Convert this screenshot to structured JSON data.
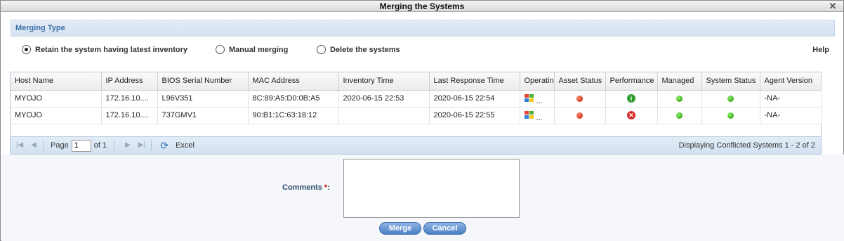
{
  "window": {
    "title": "Merging the Systems",
    "close_label": "✕"
  },
  "section": {
    "title": "Merging Type"
  },
  "merge_options": [
    {
      "label": "Retain the system having latest inventory",
      "checked": true
    },
    {
      "label": "Manual merging",
      "checked": false
    },
    {
      "label": "Delete the systems",
      "checked": false
    }
  ],
  "help_label": "Help",
  "grid": {
    "columns": [
      "Host Name",
      "IP Address",
      "BIOS Serial Number",
      "MAC Address",
      "Inventory Time",
      "Last Response Time",
      "Operating",
      "Asset Status",
      "Performance",
      "Managed",
      "System Status",
      "Agent Version"
    ],
    "rows": [
      {
        "host": "MYOJO",
        "ip": "172.16.10....",
        "bios": "L96V351",
        "mac": "8C:89:A5:D0:0B:A5",
        "inventory": "2020-06-15 22:53",
        "last_response": "2020-06-15 22:54",
        "os_icon": "windows-logo-icon",
        "os_more": "...",
        "asset_status": "red",
        "performance": "info",
        "managed": "green",
        "system_status": "green",
        "agent_version": "-NA-"
      },
      {
        "host": "MYOJO",
        "ip": "172.16.10....",
        "bios": "737GMV1",
        "mac": "90:B1:1C:63:18:12",
        "inventory": "",
        "last_response": "2020-06-15 22:55",
        "os_icon": "windows-logo-icon",
        "os_more": "...",
        "asset_status": "red",
        "performance": "error",
        "managed": "green",
        "system_status": "green",
        "agent_version": "-NA-"
      }
    ]
  },
  "pager": {
    "page_label": "Page",
    "page_value": "1",
    "of_label": "of 1",
    "excel_label": "Excel",
    "display_text": "Displaying Conflicted Systems 1 - 2 of 2"
  },
  "form": {
    "comments_label": "Comments",
    "required_mark": "*",
    "colon": ":",
    "comments_value": ""
  },
  "buttons": {
    "merge": "Merge",
    "cancel": "Cancel"
  },
  "colors": {
    "header_text": "#3f6fa8",
    "status_red": "#c41a00",
    "status_green": "#1f8c00",
    "button_blue": "#4a7fc6"
  }
}
